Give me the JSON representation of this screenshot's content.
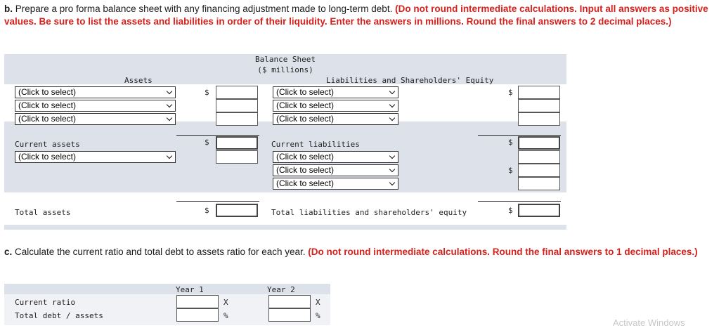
{
  "part_b": {
    "prefix": "b.",
    "text": "Prepare a pro forma balance sheet with any financing adjustment made to long-term debt.",
    "instructions": "(Do not round intermediate calculations. Input all answers as positive values. Be sure to list the assets and liabilities in order of their liquidity. Enter the answers in millions. Round the final answers to 2 decimal places.)"
  },
  "balance_sheet": {
    "title": "Balance Sheet",
    "subtitle": "($ millions)",
    "assets_header": "Assets",
    "liab_header": "Liabilities and Shareholders' Equity",
    "currency": "$",
    "select_placeholder": "(Click to select)",
    "current_assets": "Current assets",
    "current_liabilities": "Current liabilities",
    "total_assets": "Total assets",
    "total_liab_equity": "Total liabilities and shareholders' equity"
  },
  "part_c": {
    "prefix": "c.",
    "text": "Calculate the current ratio and total debt to assets ratio for each year.",
    "instructions": "(Do not round intermediate calculations. Round the final answers to 1 decimal places.)"
  },
  "ratios": {
    "year1": "Year 1",
    "year2": "Year 2",
    "current_ratio": "Current ratio",
    "debt_assets": "Total debt / assets",
    "times_unit": "X",
    "percent_unit": "%"
  },
  "watermark": "Activate Windows"
}
